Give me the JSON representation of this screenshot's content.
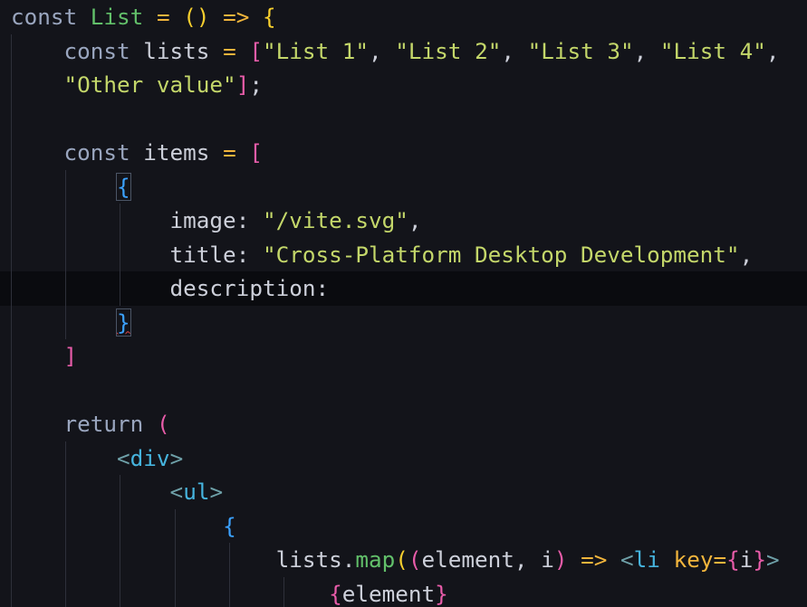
{
  "editor": {
    "language": "jsx",
    "current_line_index": 8,
    "lines": [
      [
        {
          "t": "const",
          "c": "kw"
        },
        {
          "t": " "
        },
        {
          "t": "List",
          "c": "fn"
        },
        {
          "t": " "
        },
        {
          "t": "=",
          "c": "op"
        },
        {
          "t": " "
        },
        {
          "t": "(",
          "c": "bk-yellow"
        },
        {
          "t": ")",
          "c": "bk-yellow"
        },
        {
          "t": " "
        },
        {
          "t": "=>",
          "c": "op"
        },
        {
          "t": " "
        },
        {
          "t": "{",
          "c": "bk-yellow"
        }
      ],
      [
        {
          "t": "    "
        },
        {
          "t": "const",
          "c": "kw"
        },
        {
          "t": " "
        },
        {
          "t": "lists",
          "c": "id"
        },
        {
          "t": " "
        },
        {
          "t": "=",
          "c": "op"
        },
        {
          "t": " "
        },
        {
          "t": "[",
          "c": "bk-pink"
        },
        {
          "t": "\"List 1\"",
          "c": "str"
        },
        {
          "t": ", ",
          "c": "punc"
        },
        {
          "t": "\"List 2\"",
          "c": "str"
        },
        {
          "t": ", ",
          "c": "punc"
        },
        {
          "t": "\"List 3\"",
          "c": "str"
        },
        {
          "t": ", ",
          "c": "punc"
        },
        {
          "t": "\"List 4\"",
          "c": "str"
        },
        {
          "t": ",",
          "c": "punc"
        }
      ],
      [
        {
          "t": "    "
        },
        {
          "t": "\"Other value\"",
          "c": "str"
        },
        {
          "t": "]",
          "c": "bk-pink"
        },
        {
          "t": ";",
          "c": "punc"
        }
      ],
      [],
      [
        {
          "t": "    "
        },
        {
          "t": "const",
          "c": "kw"
        },
        {
          "t": " "
        },
        {
          "t": "items",
          "c": "id"
        },
        {
          "t": " "
        },
        {
          "t": "=",
          "c": "op"
        },
        {
          "t": " "
        },
        {
          "t": "[",
          "c": "bk-pink"
        }
      ],
      [
        {
          "t": "        "
        },
        {
          "t": "{",
          "c": "bk-blue",
          "m": true
        }
      ],
      [
        {
          "t": "            "
        },
        {
          "t": "image",
          "c": "prop"
        },
        {
          "t": ": ",
          "c": "punc"
        },
        {
          "t": "\"/vite.svg\"",
          "c": "str"
        },
        {
          "t": ",",
          "c": "punc"
        }
      ],
      [
        {
          "t": "            "
        },
        {
          "t": "title",
          "c": "prop"
        },
        {
          "t": ": ",
          "c": "punc"
        },
        {
          "t": "\"Cross-Platform Desktop Development\"",
          "c": "str"
        },
        {
          "t": ",",
          "c": "punc"
        }
      ],
      [
        {
          "t": "            "
        },
        {
          "t": "description",
          "c": "prop"
        },
        {
          "t": ":",
          "c": "punc"
        }
      ],
      [
        {
          "t": "        "
        },
        {
          "t": "}",
          "c": "bk-blue",
          "m": true,
          "e": true
        }
      ],
      [
        {
          "t": "    "
        },
        {
          "t": "]",
          "c": "bk-pink"
        }
      ],
      [],
      [
        {
          "t": "    "
        },
        {
          "t": "return",
          "c": "kw"
        },
        {
          "t": " "
        },
        {
          "t": "(",
          "c": "bk-pink"
        }
      ],
      [
        {
          "t": "        "
        },
        {
          "t": "<",
          "c": "tagp"
        },
        {
          "t": "div",
          "c": "tag"
        },
        {
          "t": ">",
          "c": "tagp"
        }
      ],
      [
        {
          "t": "            "
        },
        {
          "t": "<",
          "c": "tagp"
        },
        {
          "t": "ul",
          "c": "tag"
        },
        {
          "t": ">",
          "c": "tagp"
        }
      ],
      [
        {
          "t": "                "
        },
        {
          "t": "{",
          "c": "bk-blue"
        }
      ],
      [
        {
          "t": "                    "
        },
        {
          "t": "lists",
          "c": "id"
        },
        {
          "t": ".",
          "c": "punc"
        },
        {
          "t": "map",
          "c": "method"
        },
        {
          "t": "(",
          "c": "bk-yellow"
        },
        {
          "t": "(",
          "c": "bk-pink"
        },
        {
          "t": "element",
          "c": "param"
        },
        {
          "t": ", ",
          "c": "punc"
        },
        {
          "t": "i",
          "c": "param"
        },
        {
          "t": ")",
          "c": "bk-pink"
        },
        {
          "t": " "
        },
        {
          "t": "=>",
          "c": "op"
        },
        {
          "t": " "
        },
        {
          "t": "<",
          "c": "tagp"
        },
        {
          "t": "li",
          "c": "tag"
        },
        {
          "t": " "
        },
        {
          "t": "key",
          "c": "attr"
        },
        {
          "t": "=",
          "c": "op"
        },
        {
          "t": "{",
          "c": "bk-pink"
        },
        {
          "t": "i",
          "c": "param"
        },
        {
          "t": "}",
          "c": "bk-pink"
        },
        {
          "t": ">",
          "c": "tagp"
        }
      ],
      [
        {
          "t": "                        "
        },
        {
          "t": "{",
          "c": "bk-pink"
        },
        {
          "t": "element",
          "c": "param"
        },
        {
          "t": "}",
          "c": "bk-pink"
        }
      ]
    ]
  }
}
